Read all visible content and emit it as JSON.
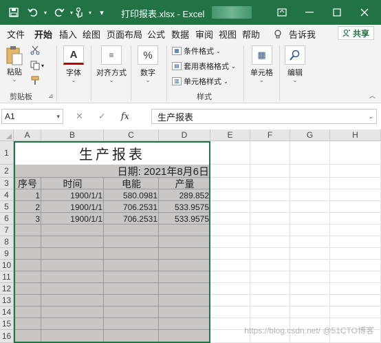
{
  "titlebar": {
    "title": "打印报表.xlsx - Excel",
    "save_icon": "save-icon",
    "undo_icon": "undo-icon",
    "redo_icon": "redo-icon",
    "touch_icon": "touch-mode-icon",
    "customize": "▾",
    "accent": "#217346"
  },
  "tabs": [
    "文件",
    "开始",
    "插入",
    "绘图",
    "页面布局",
    "公式",
    "数据",
    "审阅",
    "视图",
    "帮助"
  ],
  "active_tab": "开始",
  "tell_me": "告诉我",
  "share_label": "共享",
  "ribbon": {
    "clipboard": {
      "paste": "粘贴",
      "label": "剪贴板"
    },
    "font": {
      "label": "字体"
    },
    "alignment": {
      "label": "对齐方式"
    },
    "number": {
      "label": "数字"
    },
    "styles": {
      "conditional": "条件格式",
      "table": "套用表格格式",
      "cell_styles": "单元格样式",
      "label": "样式"
    },
    "cells": {
      "label": "单元格"
    },
    "editing": {
      "label": "编辑"
    }
  },
  "formula_bar": {
    "name_box": "A1",
    "fx": "fx",
    "value": "生产报表"
  },
  "columns": [
    "A",
    "B",
    "C",
    "D",
    "E",
    "F",
    "G",
    "H"
  ],
  "rows": [
    "1",
    "2",
    "3",
    "4",
    "5",
    "6",
    "7",
    "8",
    "9",
    "10",
    "11",
    "12",
    "13",
    "14",
    "15",
    "16"
  ],
  "sheet": {
    "title": "生产报表",
    "date": "日期: 2021年8月6日",
    "headers": [
      "序号",
      "时间",
      "电能",
      "产量"
    ],
    "data": [
      [
        "1",
        "1900/1/1",
        "580.0981",
        "289.852"
      ],
      [
        "2",
        "1900/1/1",
        "706.2531",
        "533.9575"
      ],
      [
        "3",
        "1900/1/1",
        "706.2531",
        "533.9575"
      ]
    ]
  },
  "watermark": "https://blog.csdn.net/ @51CTO博客"
}
